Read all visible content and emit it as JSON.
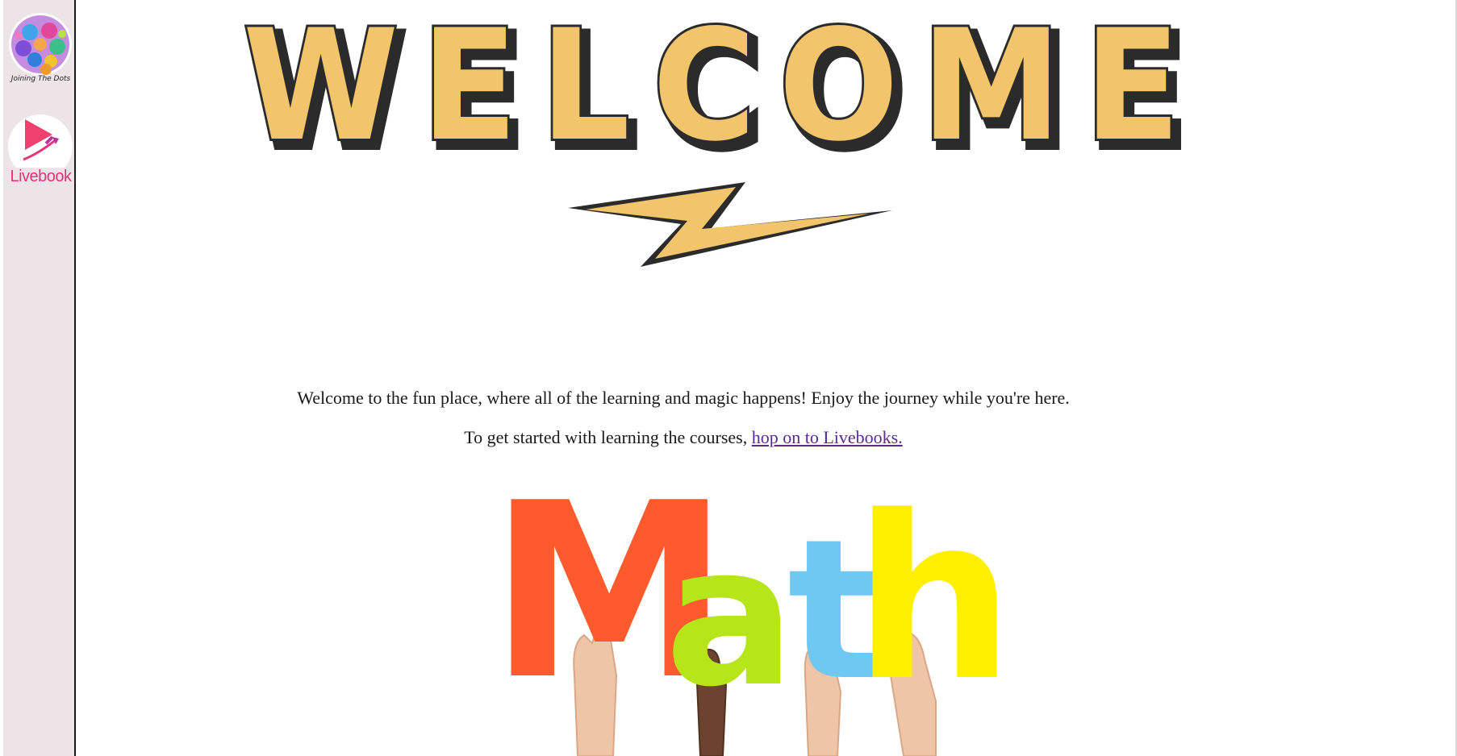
{
  "sidebar": {
    "items": [
      {
        "icon": "joining-the-dots-logo-icon",
        "label": "Joining The Dots"
      },
      {
        "icon": "livebook-logo-icon",
        "label": "Livebook"
      }
    ]
  },
  "banner": {
    "title": "WELCOME",
    "icon": "lightning-bolt-icon",
    "colors": {
      "fill": "#f2c46b",
      "outline": "#2b2b2b"
    }
  },
  "main": {
    "intro_text": "Welcome to the fun place, where all of the learning and magic happens! Enjoy the journey while you're here.",
    "cta_prefix": "To get started with learning the courses, ",
    "cta_link": "hop on to Livebooks."
  },
  "math_image": {
    "letters": [
      "M",
      "a",
      "t",
      "h"
    ],
    "colors": [
      "#ff5a2e",
      "#b6e51a",
      "#6fc8f2",
      "#fff000"
    ]
  }
}
